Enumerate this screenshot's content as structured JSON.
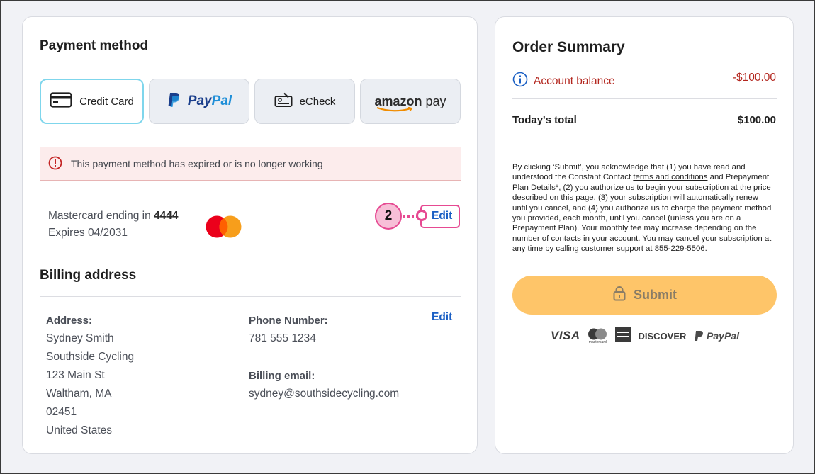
{
  "payment": {
    "title": "Payment method",
    "tabs": [
      {
        "label": "Credit Card",
        "icon": "credit-card-icon"
      },
      {
        "label_part1": "Pay",
        "label_part2": "Pal",
        "icon": "paypal-icon"
      },
      {
        "label": "eCheck",
        "icon": "check-icon"
      },
      {
        "label_part1": "amazon",
        "label_part2": " pay"
      }
    ],
    "alert": "This payment method has expired or is no longer working",
    "card_prefix": "Mastercard ending in ",
    "card_last4": "4444",
    "expires": "Expires 04/2031",
    "edit_label": "Edit",
    "callout_number": "2"
  },
  "billing": {
    "title": "Billing address",
    "edit_label": "Edit",
    "address_label": "Address:",
    "address_lines": [
      "Sydney Smith",
      "Southside Cycling",
      "123 Main St",
      "Waltham, MA",
      "02451",
      "United States"
    ],
    "phone_label": "Phone Number:",
    "phone": "781 555 1234",
    "email_label": "Billing email:",
    "email": "sydney@southsidecycling.com"
  },
  "summary": {
    "title": "Order Summary",
    "account_balance_label": "Account balance",
    "account_balance_amount": "-$100.00",
    "today_total_label": "Today's total",
    "today_total_amount": "$100.00",
    "legal_1": "By clicking ‘Submit’, you acknowledge that (1) you have read and understood the Constant Contact ",
    "legal_link": "terms and conditions",
    "legal_2": " and Prepayment Plan Details*, (2) you authorize us to begin your subscription at the price described on this page, (3) your subscription will automatically renew until you cancel, and (4) you authorize us to charge the payment method you provided, each month, until you cancel (unless you are on a Prepayment Plan). Your monthly fee may increase depending on the number of contacts in your account. You may cancel your subscription at any time by calling customer support at 855-229-5506.",
    "submit_label": "Submit",
    "brands": {
      "visa": "VISA",
      "mastercard_sub": "mastercard",
      "discover": "DISCOVER",
      "paypal1": "Pay",
      "paypal2": "Pal"
    }
  },
  "colors": {
    "accent": "#1a5fc4",
    "error": "#b3261e",
    "submit": "#fec569",
    "highlight": "#e64a92"
  }
}
